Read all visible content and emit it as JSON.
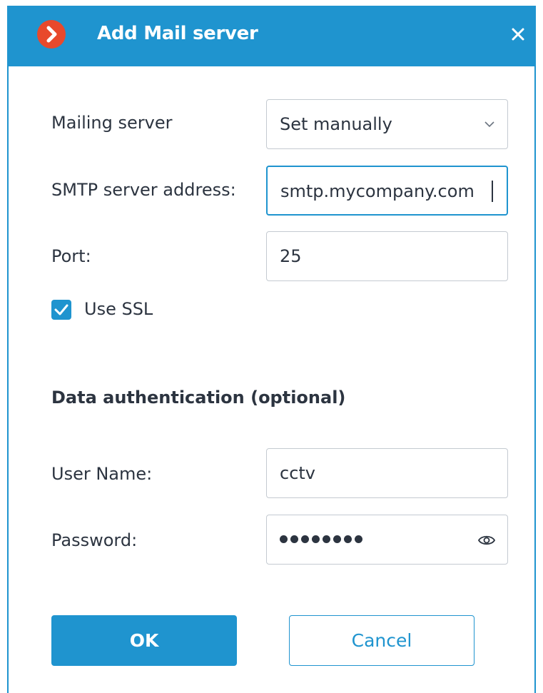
{
  "dialog": {
    "title": "Add Mail server",
    "app_icon": "chevron-right-icon",
    "close_icon": "close-icon",
    "accent_color": "#1f94cf",
    "icon_color": "#e8492c"
  },
  "form": {
    "mailing_server": {
      "label": "Mailing server",
      "value": "Set manually"
    },
    "smtp_address": {
      "label": "SMTP server address:",
      "value": "smtp.mycompany.com"
    },
    "port": {
      "label": "Port:",
      "value": "25"
    },
    "use_ssl": {
      "label": "Use SSL",
      "checked": true
    }
  },
  "auth": {
    "section_title": "Data authentication (optional)",
    "username": {
      "label": "User Name:",
      "value": "cctv"
    },
    "password": {
      "label": "Password:",
      "masked_length": 8,
      "reveal_icon": "eye-icon"
    }
  },
  "buttons": {
    "ok": "OK",
    "cancel": "Cancel"
  }
}
